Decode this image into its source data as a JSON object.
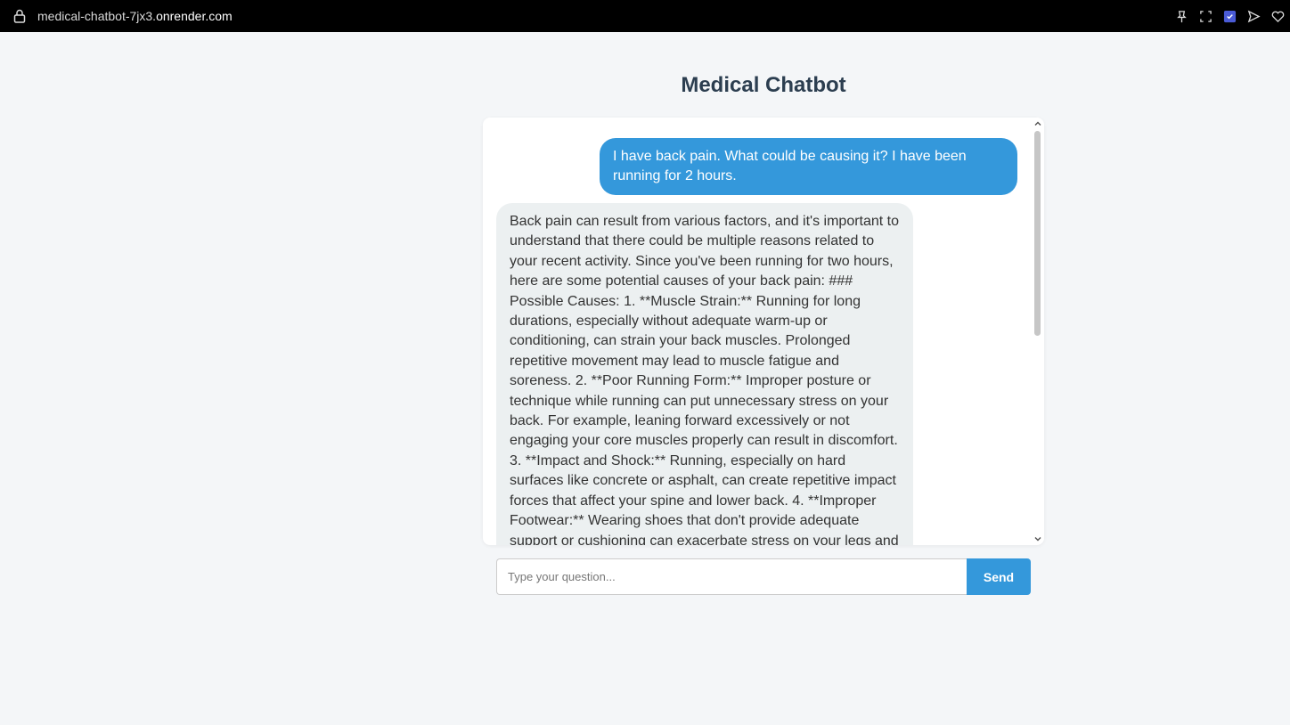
{
  "browser": {
    "url_prefix": "medical-chatbot-7jx3.",
    "url_domain": "onrender.com",
    "icons": [
      "pin-icon",
      "screenshot-icon",
      "shield-icon",
      "send-icon",
      "heart-icon"
    ]
  },
  "page": {
    "title": "Medical Chatbot"
  },
  "messages": {
    "user": "I have back pain. What could be causing it? I have been running for 2 hours.",
    "bot": "Back pain can result from various factors, and it's important to understand that there could be multiple reasons related to your recent activity. Since you've been running for two hours, here are some potential causes of your back pain: ### Possible Causes: 1. **Muscle Strain:** Running for long durations, especially without adequate warm-up or conditioning, can strain your back muscles. Prolonged repetitive movement may lead to muscle fatigue and soreness. 2. **Poor Running Form:** Improper posture or technique while running can put unnecessary stress on your back. For example, leaning forward excessively or not engaging your core muscles properly can result in discomfort. 3. **Impact and Shock:** Running, especially on hard surfaces like concrete or asphalt, can create repetitive impact forces that affect your spine and lower back. 4. **Improper Footwear:** Wearing shoes that don't provide adequate support or cushioning can exacerbate stress on your legs and"
  },
  "input": {
    "placeholder": "Type your question...",
    "send_label": "Send"
  },
  "colors": {
    "accent": "#3498db",
    "title": "#2c3e50",
    "bot_bubble": "#ecf0f1",
    "page_bg": "#f4f6f8"
  }
}
